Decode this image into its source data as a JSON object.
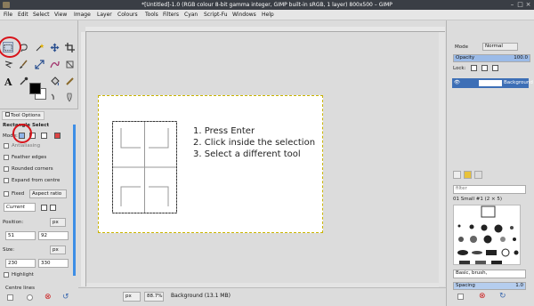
{
  "window": {
    "title": "*[Untitled]-1.0 (RGB colour 8-bit gamma integer, GIMP built-in sRGB, 1 layer) 800x500 – GIMP"
  },
  "menu": [
    "File",
    "Edit",
    "Select",
    "View",
    "Image",
    "Layer",
    "Colours",
    "Tools",
    "Filters",
    "Cyan",
    "Script-Fu",
    "Windows",
    "Help"
  ],
  "tool_options": {
    "tab_label": "Tool Options",
    "tool_name": "Rectangle Select",
    "mode_label": "Mode:",
    "antialias_label": "Antialiasing",
    "feather_label": "Feather edges",
    "rounded_label": "Rounded corners",
    "expand_label": "Expand from centre",
    "fixed_label": "Fixed",
    "aspect_value": "Aspect ratio",
    "current_value": "Current",
    "position_label": "Position:",
    "pos_unit": "px",
    "pos_x": "51",
    "pos_y": "92",
    "size_label": "Size:",
    "size_unit": "px",
    "size_w": "230",
    "size_h": "330",
    "highlight_label": "Highlight",
    "centre_lines_label": "Centre lines"
  },
  "canvas": {
    "instructions": [
      "1. Press Enter",
      "2. Click inside the selection",
      "3. Select a different tool"
    ]
  },
  "statusbar": {
    "unit": "px",
    "zoom": "88.7%",
    "layer_info": "Background (13.1 MB)"
  },
  "layers": {
    "mode_label": "Mode",
    "mode_value": "Normal",
    "opacity_label": "Opacity",
    "opacity_value": "100.0",
    "lock_label": "Lock:",
    "layer_name": "Background"
  },
  "brushes": {
    "filter_placeholder": "filter",
    "brush_name": "01 Small #1 (2 × 5)",
    "preset_value": "Basic, brush,",
    "spacing_label": "Spacing",
    "spacing_value": "1.0"
  },
  "colors": {
    "accent": "#3d8ee6",
    "annotation": "#d8131a",
    "selected_layer": "#3d6fb6"
  }
}
